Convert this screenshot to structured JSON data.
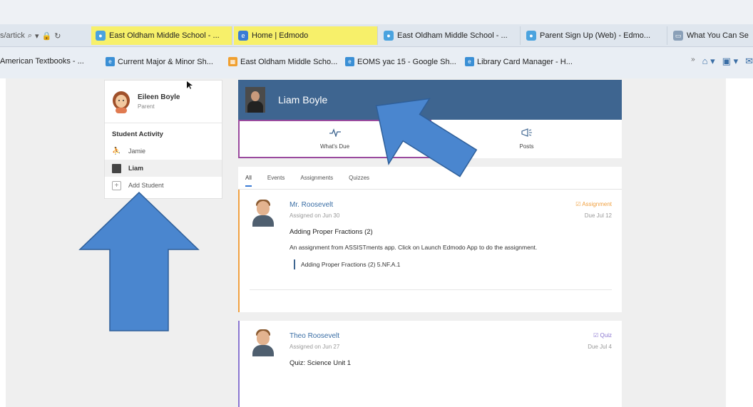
{
  "browser": {
    "address_fragment": "s/artick",
    "tabs": [
      {
        "label": "East Oldham Middle School - ...",
        "highlighted": true,
        "icon": "globe-icon"
      },
      {
        "label": "Home | Edmodo",
        "highlighted": true,
        "icon": "edmodo-icon"
      },
      {
        "label": "East Oldham Middle School - ...",
        "highlighted": false,
        "icon": "globe-icon"
      },
      {
        "label": "Parent Sign Up (Web) - Edmo...",
        "highlighted": false,
        "icon": "globe-icon"
      },
      {
        "label": "What You Can Se",
        "highlighted": false,
        "icon": "page-icon"
      }
    ],
    "favorites": [
      {
        "label": "American Textbooks - ..."
      },
      {
        "label": "Current Major & Minor Sh..."
      },
      {
        "label": "East Oldham Middle Scho..."
      },
      {
        "label": "EOMS yac 15 - Google Sh..."
      },
      {
        "label": "Library Card Manager - H..."
      }
    ],
    "chevron": "»"
  },
  "sidebar": {
    "user_name": "Eileen Boyle",
    "user_role": "Parent",
    "section_title": "Student Activity",
    "items": [
      {
        "label": "Jamie",
        "active": false
      },
      {
        "label": "Liam",
        "active": true
      },
      {
        "label": "Add Student",
        "active": false
      }
    ]
  },
  "student": {
    "name": "Liam Boyle"
  },
  "nav_tabs": [
    {
      "label": "What's Due",
      "icon": "pulse-icon",
      "selected": true
    },
    {
      "label": "Posts",
      "icon": "megaphone-icon",
      "selected": false
    }
  ],
  "filter_tabs": [
    "All",
    "Events",
    "Assignments",
    "Quizzes"
  ],
  "cards": [
    {
      "teacher": "Mr. Roosevelt",
      "assigned": "Assigned on Jun 30",
      "kind": "Assignment",
      "kind_color": "#f0a040",
      "due": "Due Jul 12",
      "title": "Adding Proper Fractions (2)",
      "description": "An assignment from ASSISTments app. Click on Launch Edmodo App to do the assignment.",
      "link": "Adding Proper Fractions (2) 5.NF.A.1"
    },
    {
      "teacher": "Theo Roosevelt",
      "assigned": "Assigned on Jun 27",
      "kind": "Quiz",
      "kind_color": "#8a76d0",
      "due": "Due Jul 4",
      "title": "Quiz: Science Unit 1"
    }
  ],
  "colors": {
    "header": "#3e6590",
    "arrow": "#4a86cf",
    "selected_tab_border": "#9a4a9e"
  }
}
